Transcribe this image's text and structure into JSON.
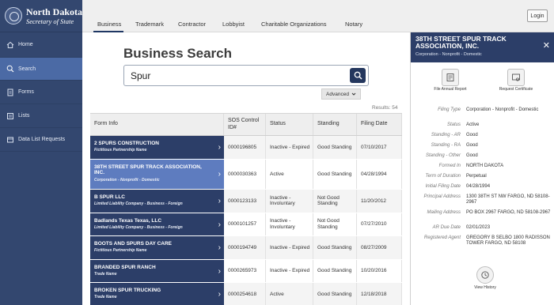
{
  "brand": {
    "name": "North Dakota",
    "subtitle": "Secretary of State"
  },
  "sidebar": {
    "items": [
      {
        "label": "Home",
        "icon": "home-icon"
      },
      {
        "label": "Search",
        "icon": "search-icon"
      },
      {
        "label": "Forms",
        "icon": "document-icon"
      },
      {
        "label": "Lists",
        "icon": "list-icon"
      },
      {
        "label": "Data List Requests",
        "icon": "data-icon"
      }
    ]
  },
  "header": {
    "tabs": [
      "Business",
      "Trademark",
      "Contractor",
      "Lobbyist",
      "Charitable Organizations",
      "Notary"
    ],
    "login": "Login"
  },
  "main": {
    "title": "Business Search",
    "search_value": "Spur",
    "advanced": "Advanced",
    "results": "Results: 54"
  },
  "table": {
    "headers": [
      "Form Info",
      "SOS Control ID#",
      "Status",
      "Standing",
      "Filing Date"
    ],
    "rows": [
      {
        "name": "2 SPURS CONSTRUCTION",
        "type": "Fictitious Partnership Name",
        "id": "0000196805",
        "status": "Inactive - Expired",
        "standing": "Good Standing",
        "date": "07/10/2017"
      },
      {
        "name": "38TH STREET SPUR TRACK ASSOCIATION, INC.",
        "type": "Corporation - Nonprofit - Domestic",
        "id": "0000030363",
        "status": "Active",
        "standing": "Good Standing",
        "date": "04/28/1994"
      },
      {
        "name": "B SPUR LLC",
        "type": "Limited Liability Company - Business - Foreign",
        "id": "0000123133",
        "status": "Inactive - Involuntary",
        "standing": "Not Good Standing",
        "date": "11/20/2012"
      },
      {
        "name": "Badlands Texas Texas, LLC",
        "type": "Limited Liability Company - Business - Foreign",
        "id": "0000101257",
        "status": "Inactive - Involuntary",
        "standing": "Not Good Standing",
        "date": "07/27/2010"
      },
      {
        "name": "BOOTS AND SPURS DAY CARE",
        "type": "Fictitious Partnership Name",
        "id": "0000194749",
        "status": "Inactive - Expired",
        "standing": "Good Standing",
        "date": "08/27/2009"
      },
      {
        "name": "BRANDED SPUR RANCH",
        "type": "Trade Name",
        "id": "0000265973",
        "status": "Inactive - Expired",
        "standing": "Good Standing",
        "date": "10/20/2016"
      },
      {
        "name": "BROKEN SPUR TRUCKING",
        "type": "Trade Name",
        "id": "0000254618",
        "status": "Active",
        "standing": "Good Standing",
        "date": "12/18/2018"
      }
    ]
  },
  "panel": {
    "title": "38TH STREET SPUR TRACK ASSOCIATION, INC.",
    "subtitle": "Corporation - Nonprofit - Domestic",
    "actions": [
      "File Annual Report",
      "Request Certificate"
    ],
    "details": [
      {
        "label": "Filing Type",
        "value": "Corporation - Nonprofit - Domestic"
      },
      {
        "label": "Status",
        "value": "Active"
      },
      {
        "label": "Standing - AR",
        "value": "Good"
      },
      {
        "label": "Standing - RA",
        "value": "Good"
      },
      {
        "label": "Standing - Other",
        "value": "Good"
      },
      {
        "label": "Formed In",
        "value": "NORTH DAKOTA"
      },
      {
        "label": "Term of Duration",
        "value": "Perpetual"
      },
      {
        "label": "Initial Filing Date",
        "value": "04/28/1994"
      },
      {
        "label": "Principal Address",
        "value": "1300 38TH ST NW FARGO, ND 58108-2967"
      },
      {
        "label": "Mailing Address",
        "value": "PO BOX 2967 FARGO, ND 58108-2967"
      },
      {
        "label": "AR Due Date",
        "value": "02/01/2023"
      },
      {
        "label": "Registered Agent",
        "value": "GREGORY B SELBO 1800 RADISSON TOWER FARGO, ND 58108"
      }
    ],
    "history": "View History"
  }
}
